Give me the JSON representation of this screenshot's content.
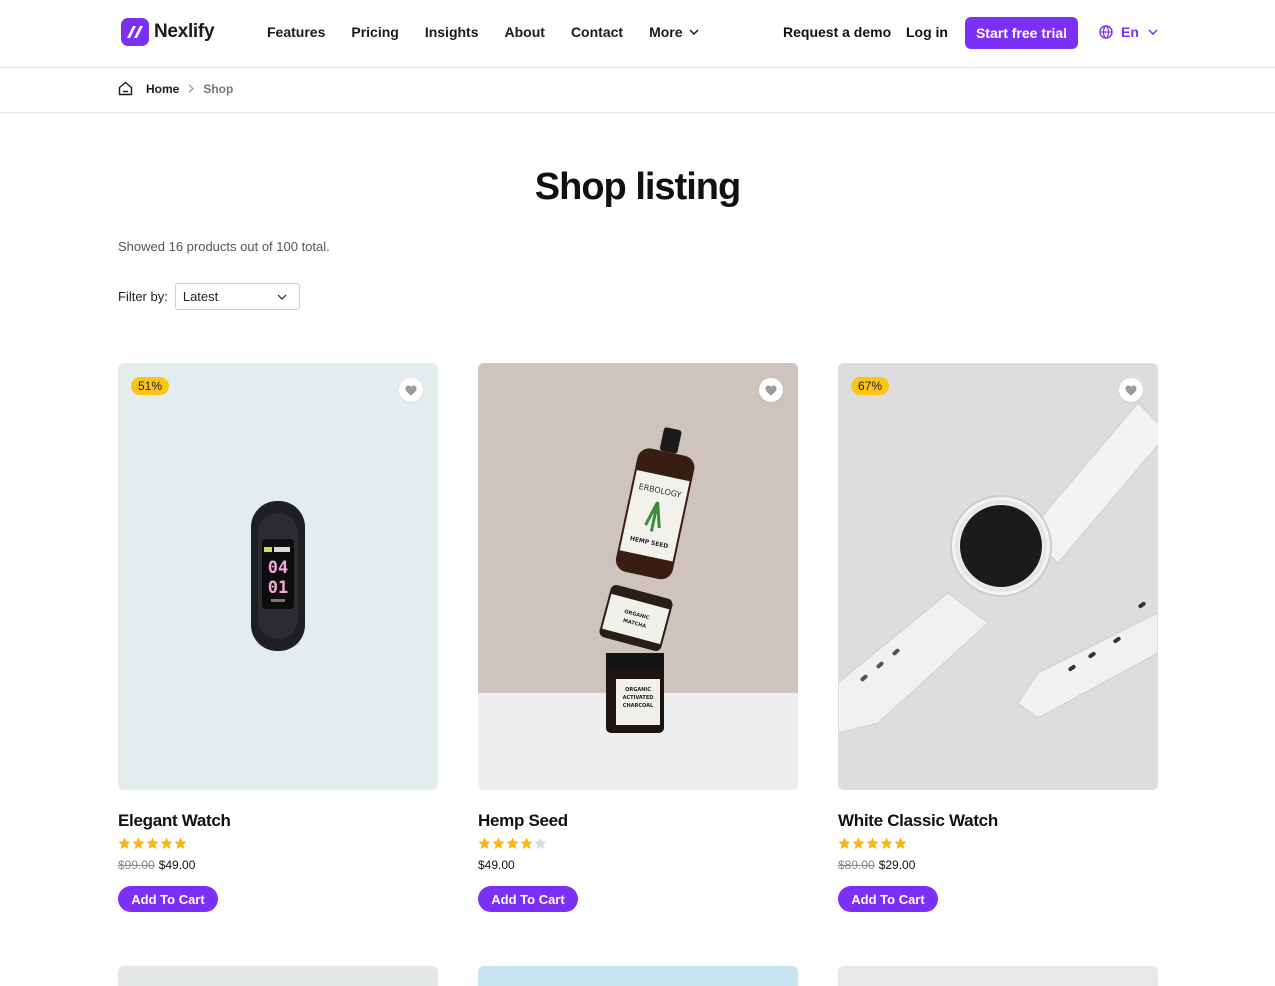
{
  "brand": {
    "name": "Nexlify",
    "accent": "#7b2ff7"
  },
  "nav": {
    "items": [
      "Features",
      "Pricing",
      "Insights",
      "About",
      "Contact",
      "More"
    ],
    "request_demo": "Request a demo",
    "login": "Log in",
    "trial": "Start free trial",
    "language": "En"
  },
  "breadcrumb": {
    "home": "Home",
    "current": "Shop"
  },
  "page": {
    "title": "Shop listing",
    "summary": "Showed 16 products out of 100 total.",
    "filter_label": "Filter by:",
    "filter_value": "Latest"
  },
  "products": [
    {
      "name": "Elegant Watch",
      "badge": "51%",
      "rating": 5,
      "old_price": "$99.00",
      "price": "$49.00",
      "cta": "Add To Cart",
      "image": "fitness-band"
    },
    {
      "name": "Hemp Seed",
      "badge": "",
      "rating": 4,
      "old_price": "",
      "price": "$49.00",
      "cta": "Add To Cart",
      "image": "hemp-seed-bottles"
    },
    {
      "name": "White Classic Watch",
      "badge": "67%",
      "rating": 5,
      "old_price": "$89.00",
      "price": "$29.00",
      "cta": "Add To Cart",
      "image": "white-smartwatch"
    }
  ],
  "colors": {
    "badge": "#fcc419",
    "star": "#fcb514",
    "star_empty": "#d9d9d9"
  }
}
